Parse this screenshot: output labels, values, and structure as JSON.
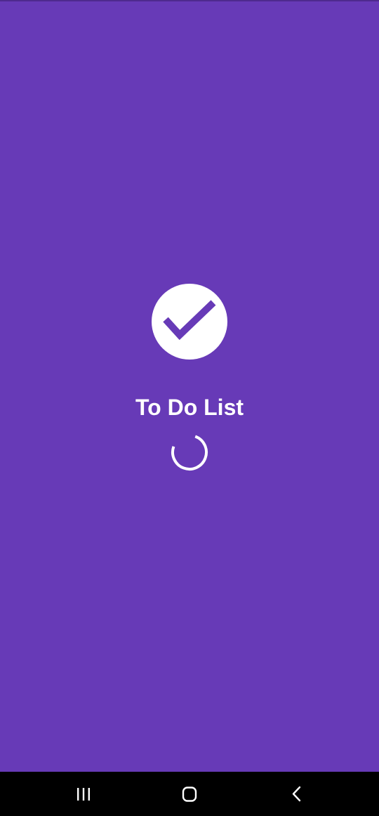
{
  "app": {
    "title": "To Do List",
    "background_color": "#673ab7",
    "foreground_color": "#ffffff"
  },
  "logo": {
    "icon": "check-circle-icon"
  },
  "loading": {
    "icon": "loading-spinner-icon"
  },
  "navigation_bar": {
    "background_color": "#000000",
    "buttons": [
      {
        "icon": "recent-apps-icon"
      },
      {
        "icon": "home-icon"
      },
      {
        "icon": "back-icon"
      }
    ]
  }
}
